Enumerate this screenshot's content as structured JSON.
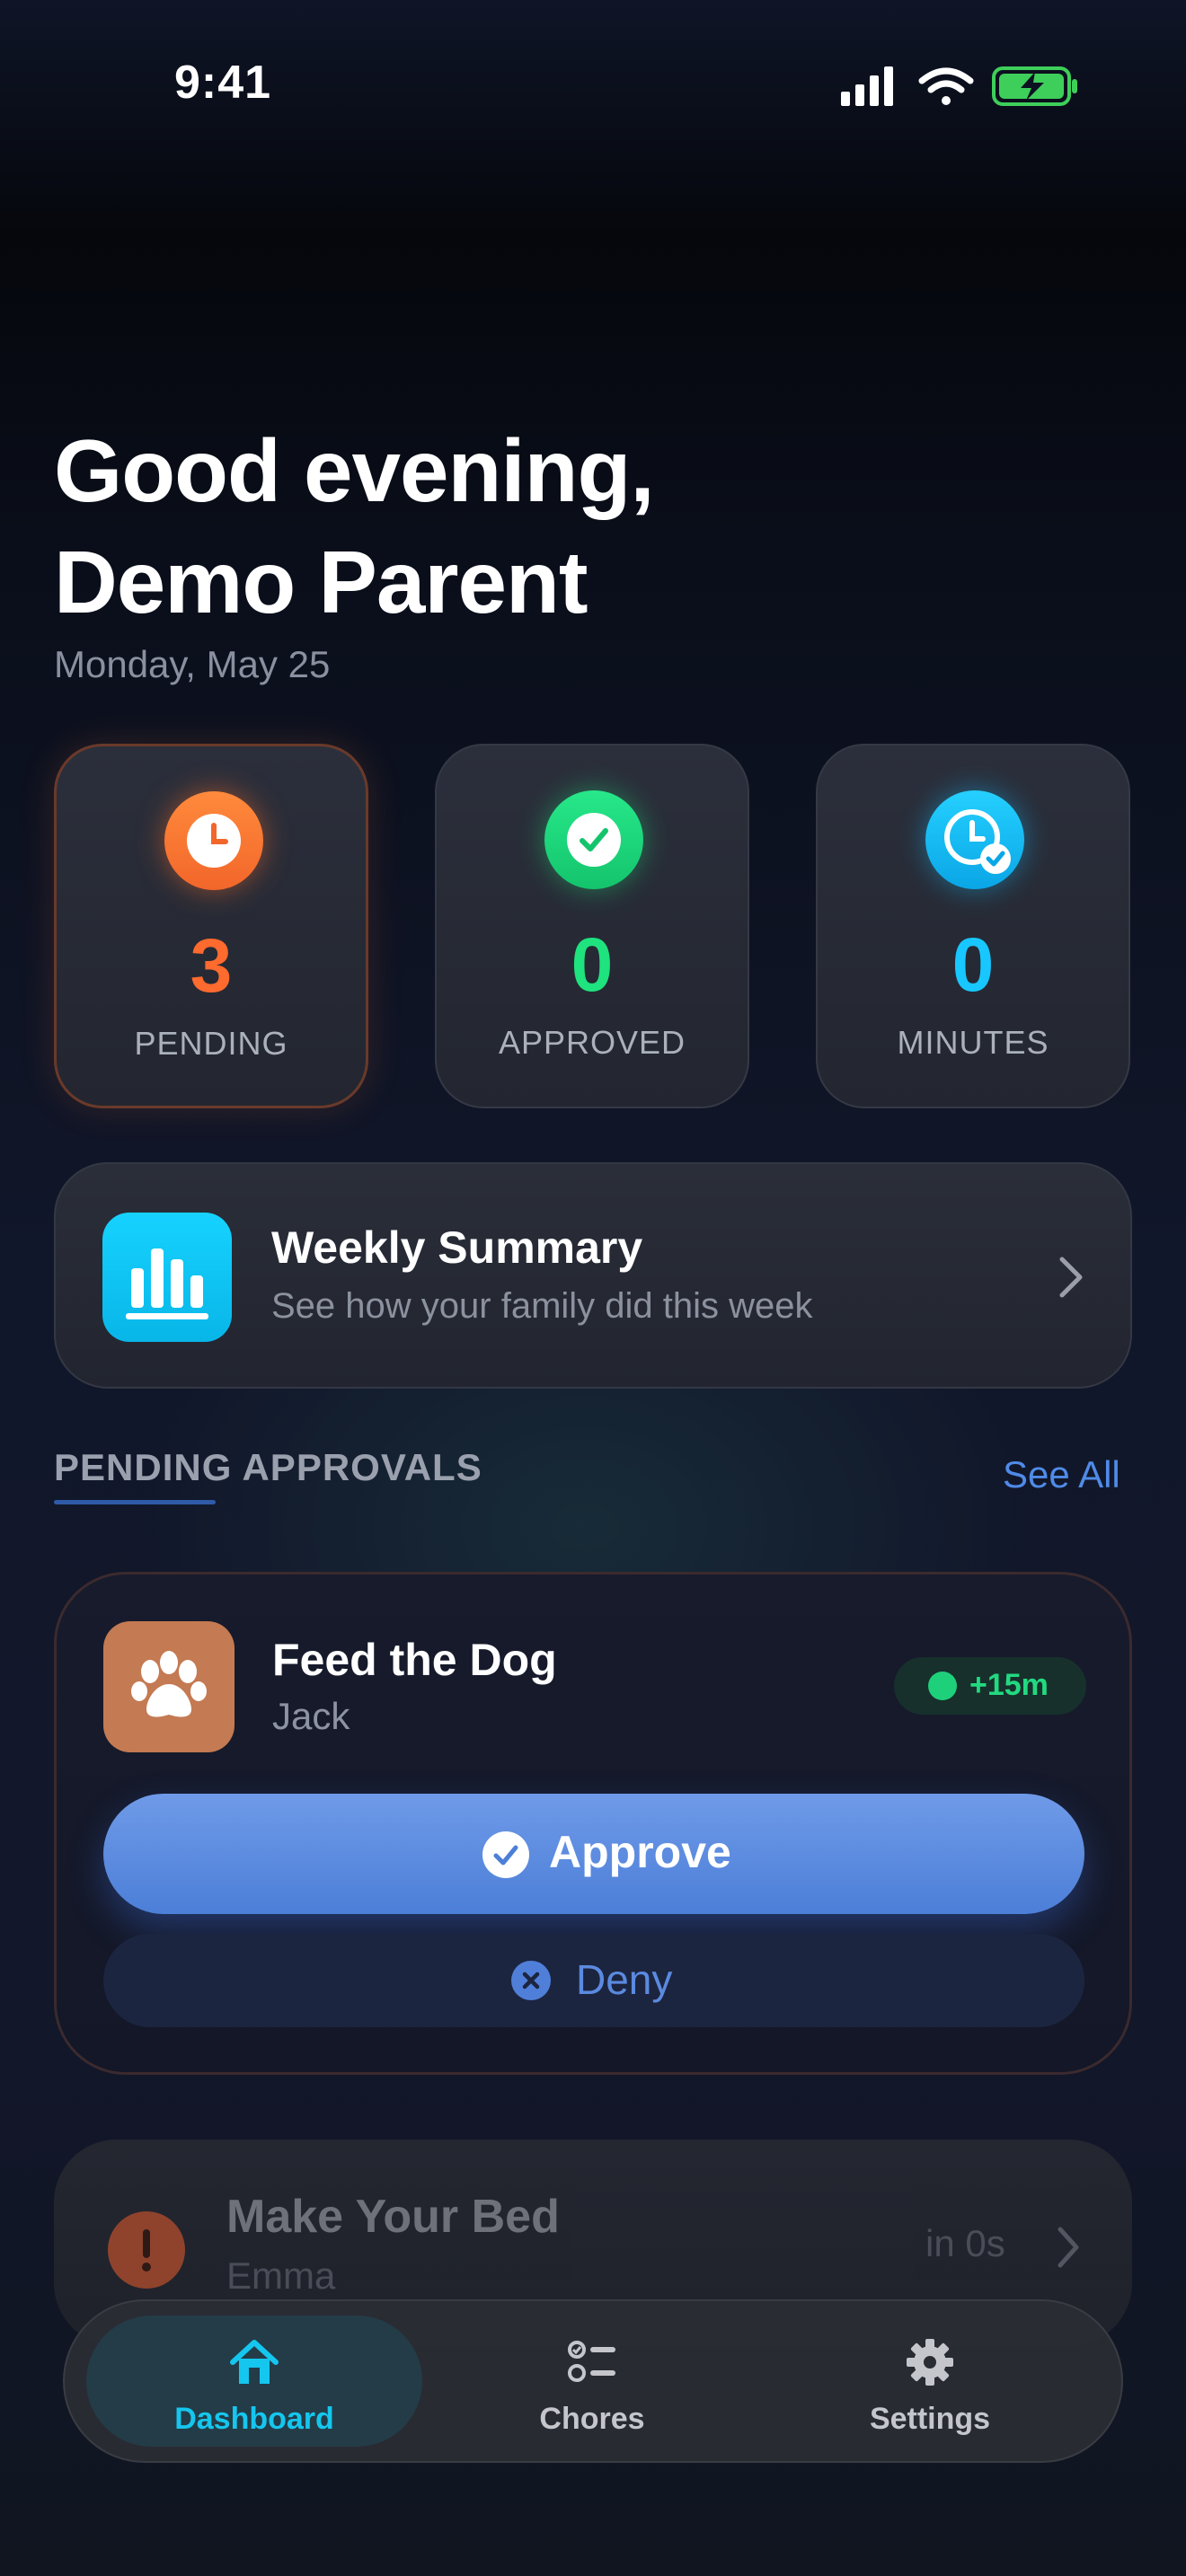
{
  "status_bar": {
    "time": "9:41"
  },
  "header": {
    "greeting_line1": "Good evening,",
    "greeting_line2": "Demo Parent",
    "date": "Monday, May 25"
  },
  "stats": [
    {
      "value": "3",
      "label": "PENDING",
      "color": "#ff6a2e"
    },
    {
      "value": "0",
      "label": "APPROVED",
      "color": "#1ee37e"
    },
    {
      "value": "0",
      "label": "MINUTES",
      "color": "#18c7ff"
    }
  ],
  "weekly_summary": {
    "title": "Weekly Summary",
    "subtitle": "See how your family did this week"
  },
  "pending_section": {
    "title": "PENDING APPROVALS",
    "see_all": "See All"
  },
  "approval_card": {
    "chore": "Feed the Dog",
    "child": "Jack",
    "reward": "+15m",
    "approve_label": "Approve",
    "deny_label": "Deny",
    "icon": "paw-icon"
  },
  "next_chore": {
    "chore": "Make Your Bed",
    "child": "Emma",
    "meta": "in 0s"
  },
  "tab_bar": {
    "tabs": [
      {
        "label": "Dashboard",
        "icon": "home-icon",
        "active": true
      },
      {
        "label": "Chores",
        "icon": "checklist-icon",
        "active": false
      },
      {
        "label": "Settings",
        "icon": "gear-icon",
        "active": false
      }
    ]
  },
  "colors": {
    "accent_blue": "#4f8be8",
    "pending_orange": "#ff6a2e",
    "approved_green": "#1ee37e",
    "minutes_cyan": "#18c7ff"
  }
}
